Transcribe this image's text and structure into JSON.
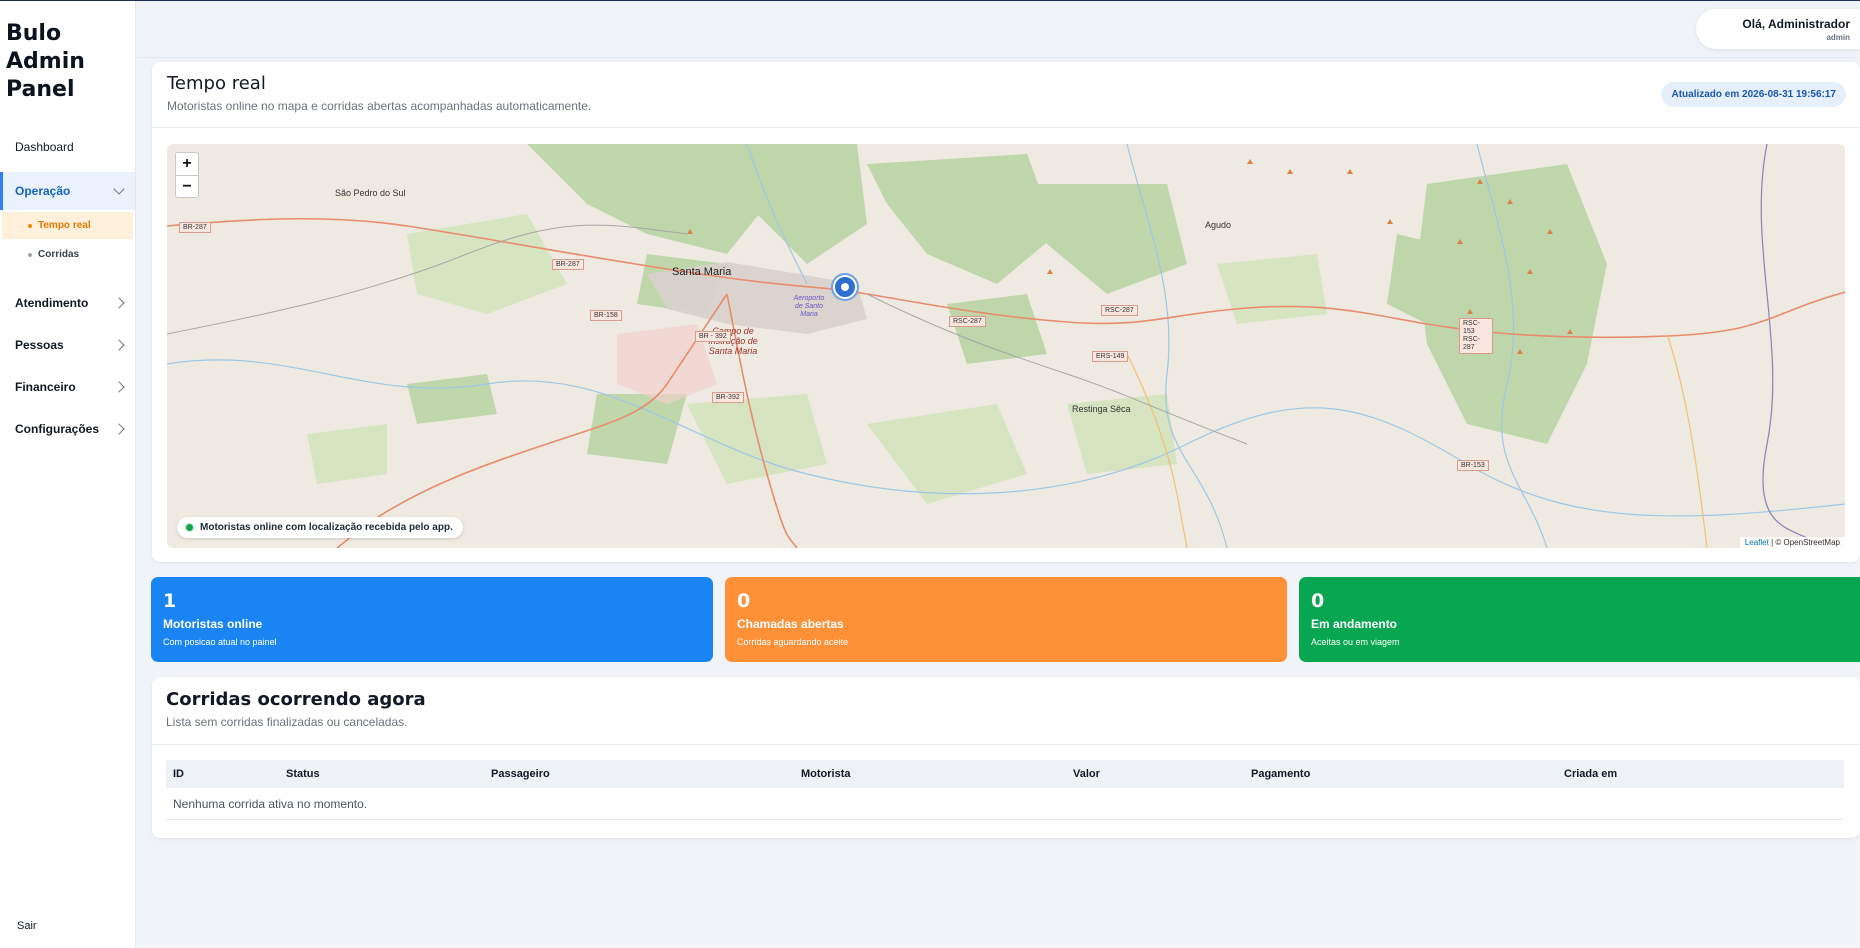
{
  "brand": "Bulo Admin Panel",
  "sidebar": {
    "dashboard": "Dashboard",
    "operacao": "Operação",
    "sub_items": [
      "Tempo real",
      "Corridas"
    ],
    "atendimento": "Atendimento",
    "pessoas": "Pessoas",
    "financeiro": "Financeiro",
    "configuracoes": "Configurações",
    "logout": "Sair"
  },
  "header": {
    "greeting": "Olá, Administrador",
    "role": "admin"
  },
  "realtime": {
    "title": "Tempo real",
    "subtitle": "Motoristas online no mapa e corridas abertas acompanhadas automaticamente.",
    "updated": "Atualizado em 2026-08-31 19:56:17"
  },
  "map": {
    "zoom_in": "+",
    "zoom_out": "−",
    "legend": "Motoristas online com localização recebida pelo app.",
    "attribution_leaflet": "Leaflet",
    "attribution_osm": "| © OpenStreetMap",
    "places": {
      "santa_maria": "Santa Maria",
      "sao_pedro": "São Pedro do Sul",
      "agudo": "Agudo",
      "restinga": "Restinga Sêca",
      "campo": "Campo de Instrução de Santa Maria",
      "airport": "Aeroporto de Santo Maria"
    },
    "roads": {
      "br287_w": "BR-287",
      "br287_c": "BR-287",
      "br158": "BR-158",
      "br392_a": "BR - 392",
      "br392_b": "BR-392",
      "rsc287_a": "RSC-287",
      "rsc287_b": "RSC-287",
      "ers149": "ERS-149",
      "rsc153": "RSC-153 RSC-287",
      "br153": "BR-153"
    },
    "online_drivers": 1
  },
  "stats": {
    "online": {
      "value": "1",
      "label": "Motoristas online",
      "sub": "Com posicao atual no painel"
    },
    "open": {
      "value": "0",
      "label": "Chamadas abertas",
      "sub": "Corridas aguardando aceite"
    },
    "ongoing": {
      "value": "0",
      "label": "Em andamento",
      "sub": "Aceitas ou em viagem"
    }
  },
  "rides": {
    "title": "Corridas ocorrendo agora",
    "subtitle": "Lista sem corridas finalizadas ou canceladas.",
    "columns": [
      "ID",
      "Status",
      "Passageiro",
      "Motorista",
      "Valor",
      "Pagamento",
      "Criada em"
    ],
    "empty": "Nenhuma corrida ativa no momento."
  },
  "colors": {
    "blue": "#1a85f2",
    "orange": "#fe9038",
    "green": "#08a650",
    "accent": "#1565c0"
  }
}
